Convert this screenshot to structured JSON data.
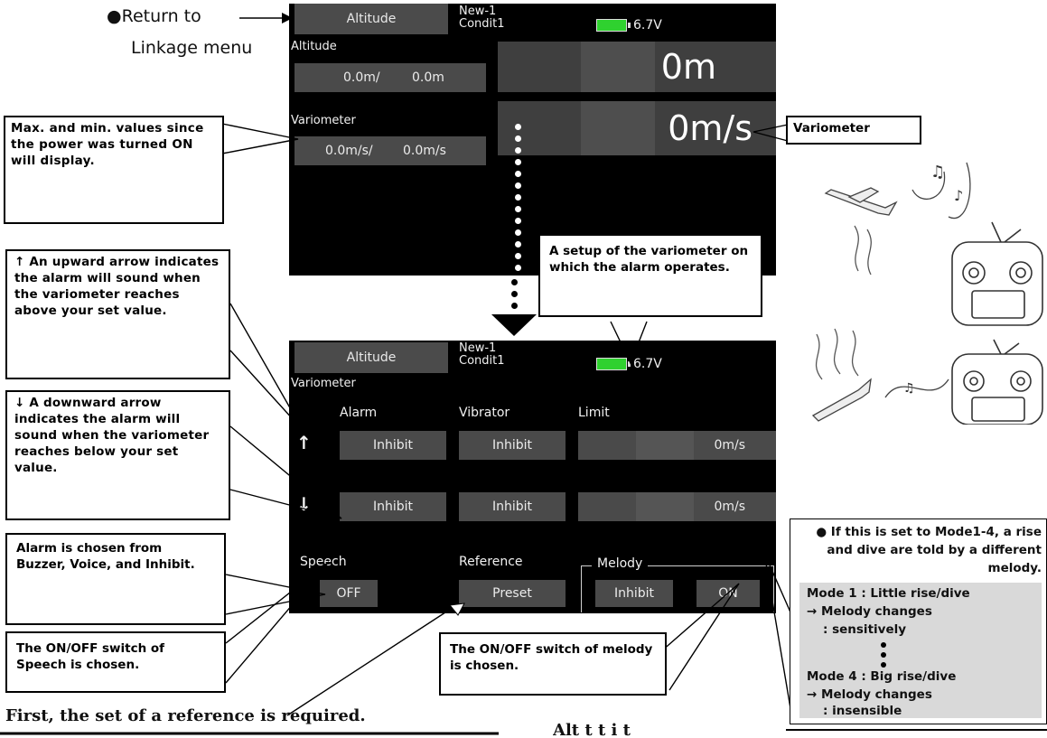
{
  "top_annotation": {
    "bullet": "●",
    "return_line1": "Return to",
    "return_line2": "Linkage menu"
  },
  "screen1": {
    "tab_title": "Altitude",
    "model": "New-1",
    "condition": "Condit1",
    "voltage": "6.7V",
    "altitude_label": "Altitude",
    "altitude_max": "0.0m/",
    "altitude_min": "0.0m",
    "altitude_value": "0m",
    "variometer_label": "Variometer",
    "vario_max": "0.0m/s/",
    "vario_min": "0.0m/s",
    "vario_value": "0m/s"
  },
  "screen2": {
    "tab_title": "Altitude",
    "model": "New-1",
    "condition": "Condit1",
    "voltage": "6.7V",
    "section": "Variometer",
    "col_alarm": "Alarm",
    "col_vibrator": "Vibrator",
    "col_limit": "Limit",
    "up_arrow": "↑",
    "down_arrow": "↓",
    "up_alarm": "Inhibit",
    "up_vibrator": "Inhibit",
    "up_limit": "0m/s",
    "down_alarm": "Inhibit",
    "down_vibrator": "Inhibit",
    "down_limit": "0m/s",
    "speech_label": "Speech",
    "speech_value": "OFF",
    "reference_label": "Reference",
    "reference_value": "Preset",
    "melody_label": "Melody",
    "melody_inhibit": "Inhibit",
    "melody_on": "ON"
  },
  "callouts": {
    "maxmin": "Max. and min. values since the power was turned ON will display.",
    "variometer": "Variometer",
    "setup": "A setup of the variometer on which the alarm operates.",
    "upward": "↑ An upward arrow indicates the alarm will sound when the variometer reaches above your set value.",
    "downward": "↓ A downward arrow indicates the alarm will sound when the variometer reaches below your set value.",
    "alarm_choice": "Alarm is chosen from Buzzer, Voice, and Inhibit.",
    "speech_switch": "The ON/OFF switch of Speech is chosen.",
    "melody_switch": "The ON/OFF switch of melody is chosen."
  },
  "info_panel": {
    "bullet_text": "● If this is set to Mode1-4, a rise and dive are told by a different melody.",
    "mode1_title": "Mode 1 : Little rise/dive",
    "mode1_line1": "→ Melody changes",
    "mode1_line2": ": sensitively",
    "mode4_title": "Mode 4 : Big rise/dive",
    "mode4_line1": "→ Melody changes",
    "mode4_line2": ": insensible"
  },
  "footer": {
    "note": "First, the set of a reference is required.",
    "cut_text": "Alt t t    i   t"
  },
  "icons": [
    "battery-icon",
    "glider-rising-icon",
    "glider-diving-icon",
    "transmitter-icon",
    "music-note-icon"
  ],
  "colors": {
    "screen_bg": "#000000",
    "field_bg": "#4a4a4a",
    "battery": "#2fd12f",
    "panel_bg": "#d9d9d9"
  }
}
